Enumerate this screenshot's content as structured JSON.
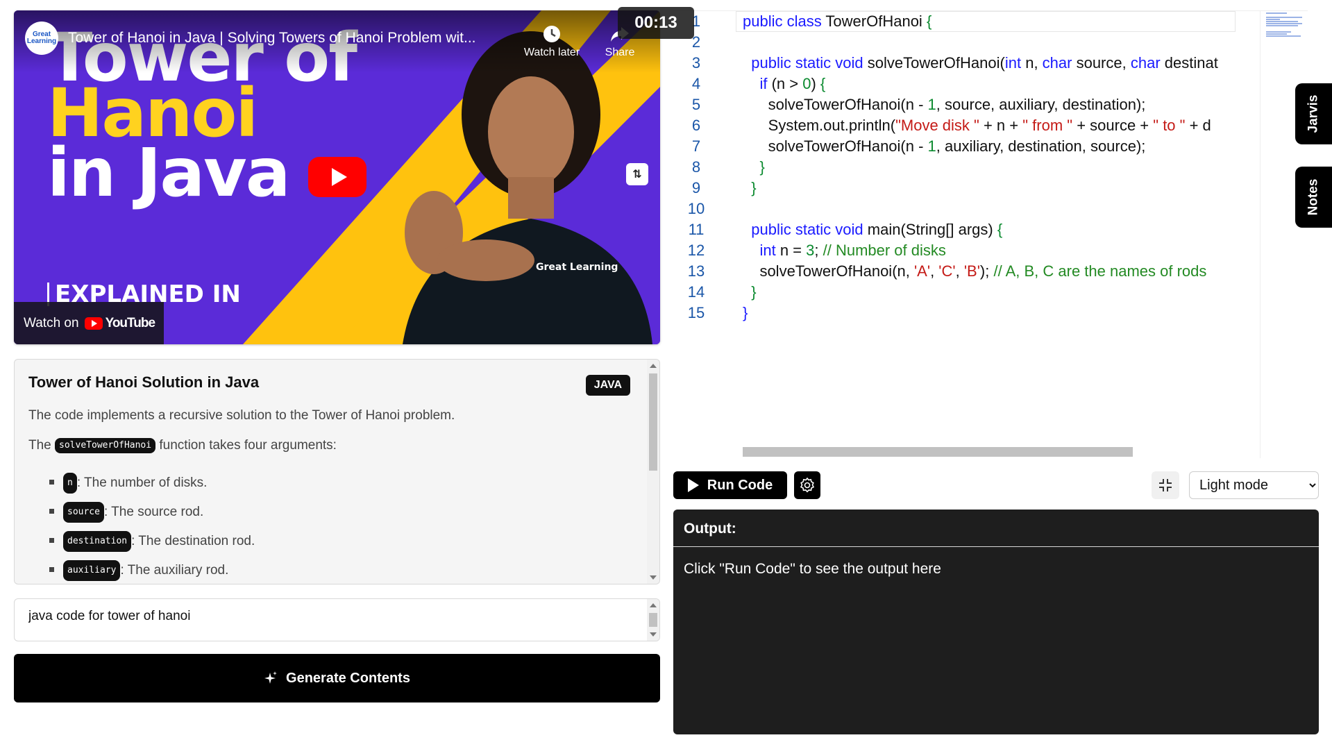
{
  "video": {
    "channel_logo_text": "Great Learning",
    "title": "Tower of Hanoi in Java | Solving Towers of Hanoi Problem wit...",
    "watch_later_label": "Watch later",
    "share_label": "Share",
    "timer": "00:13",
    "thumbnail": {
      "line1": "Tower of",
      "line2": "Hanoi",
      "line3": "in Java",
      "tagline": "EXPLAINED IN",
      "shirt_logo": "Great Learning"
    },
    "watch_on_label": "Watch on",
    "youtube_label": "YouTube",
    "colors": {
      "purple": "#5b2bd8",
      "yellow": "#ffc20e",
      "play_red": "#ff0000"
    }
  },
  "description": {
    "title": "Tower of Hanoi Solution in Java",
    "language_badge": "JAVA",
    "intro": "The code implements a recursive solution to the Tower of Hanoi problem.",
    "args_prefix": "The",
    "function_name": "solveTowerOfHanoi",
    "args_suffix": "function takes four arguments:",
    "arguments": [
      {
        "name": "n",
        "text": ": The number of disks."
      },
      {
        "name": "source",
        "text": ": The source rod."
      },
      {
        "name": "destination",
        "text": ": The destination rod."
      },
      {
        "name": "auxiliary",
        "text": ": The auxiliary rod."
      }
    ]
  },
  "prompt": {
    "value": "java code for tower of hanoi"
  },
  "generate_button_label": "Generate Contents",
  "editor": {
    "line_numbers": [
      "1",
      "2",
      "3",
      "4",
      "5",
      "6",
      "7",
      "8",
      "9",
      "10",
      "11",
      "12",
      "13",
      "14",
      "15"
    ]
  },
  "side_tabs": {
    "jarvis": "Jarvis",
    "notes": "Notes"
  },
  "toolbar": {
    "run_label": "Run Code",
    "theme_selected": "Light mode",
    "theme_options": [
      "Light mode"
    ]
  },
  "output": {
    "header": "Output:",
    "placeholder": "Click \"Run Code\" to see the output here"
  }
}
